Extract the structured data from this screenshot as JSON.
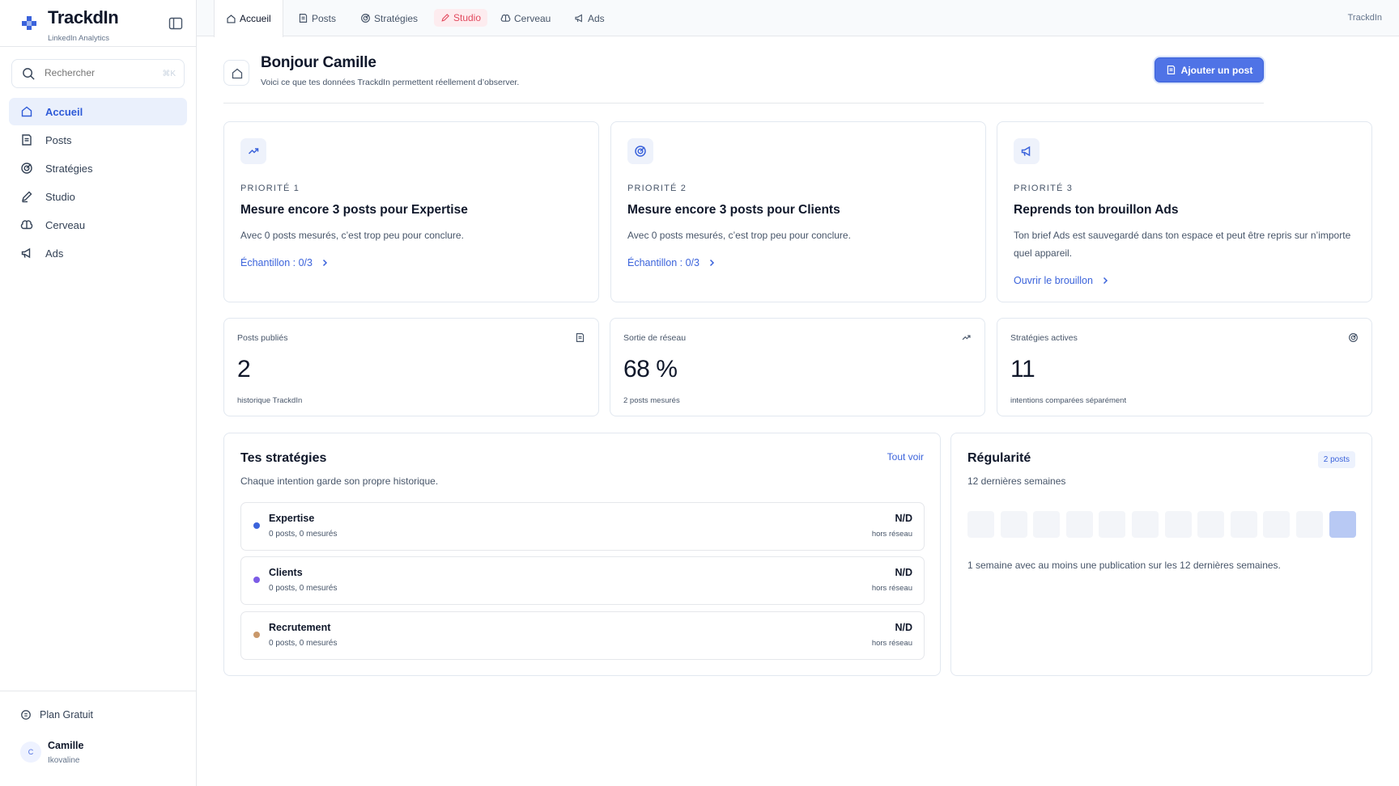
{
  "brand": {
    "name": "TrackdIn",
    "subtitle": "LinkedIn Analytics"
  },
  "search": {
    "placeholder": "Rechercher",
    "shortcut": "⌘K"
  },
  "sidebar": {
    "items": [
      {
        "label": "Accueil",
        "icon": "home-icon",
        "active": true
      },
      {
        "label": "Posts",
        "icon": "file-icon"
      },
      {
        "label": "Stratégies",
        "icon": "target-icon"
      },
      {
        "label": "Studio",
        "icon": "pen-icon"
      },
      {
        "label": "Cerveau",
        "icon": "brain-icon"
      },
      {
        "label": "Ads",
        "icon": "megaphone-icon"
      }
    ],
    "plan": "Plan Gratuit",
    "user": {
      "initial": "C",
      "name": "Camille",
      "org": "Ikovaline"
    }
  },
  "tabs": [
    {
      "label": "Accueil"
    },
    {
      "label": "Posts"
    },
    {
      "label": "Stratégies"
    },
    {
      "label": "Studio"
    },
    {
      "label": "Cerveau"
    },
    {
      "label": "Ads"
    }
  ],
  "tabbar_right": "TrackdIn",
  "header": {
    "title": "Bonjour Camille",
    "subtitle": "Voici ce que tes données TrackdIn permettent réellement d’observer.",
    "add_button": "Ajouter un post"
  },
  "priorities": [
    {
      "label": "PRIORITÉ 1",
      "title": "Mesure encore 3 posts pour Expertise",
      "desc": "Avec 0 posts mesurés, c’est trop peu pour conclure.",
      "link": "Échantillon : 0/3"
    },
    {
      "label": "PRIORITÉ 2",
      "title": "Mesure encore 3 posts pour Clients",
      "desc": "Avec 0 posts mesurés, c’est trop peu pour conclure.",
      "link": "Échantillon : 0/3"
    },
    {
      "label": "PRIORITÉ 3",
      "title": "Reprends ton brouillon Ads",
      "desc": "Ton brief Ads est sauvegardé dans ton espace et peut être repris sur n’importe quel appareil.",
      "link": "Ouvrir le brouillon"
    }
  ],
  "stats": [
    {
      "label": "Posts publiés",
      "value": "2",
      "note": "historique TrackdIn"
    },
    {
      "label": "Sortie de réseau",
      "value": "68 %",
      "note": "2 posts mesurés"
    },
    {
      "label": "Stratégies actives",
      "value": "11",
      "note": "intentions comparées séparément"
    }
  ],
  "strategies": {
    "title": "Tes stratégies",
    "subtitle": "Chaque intention garde son propre historique.",
    "see_all": "Tout voir",
    "rows": [
      {
        "name": "Expertise",
        "meta": "0 posts, 0 mesurés",
        "value": "N/D",
        "value_note": "hors réseau",
        "color": "#3b63db"
      },
      {
        "name": "Clients",
        "meta": "0 posts, 0 mesurés",
        "value": "N/D",
        "value_note": "hors réseau",
        "color": "#7c5ce6"
      },
      {
        "name": "Recrutement",
        "meta": "0 posts, 0 mesurés",
        "value": "N/D",
        "value_note": "hors réseau",
        "color": "#c9986b"
      }
    ]
  },
  "regularity": {
    "title": "Régularité",
    "subtitle": "12 dernières semaines",
    "badge": "2 posts",
    "weeks_active": [
      false,
      false,
      false,
      false,
      false,
      false,
      false,
      false,
      false,
      false,
      false,
      true
    ],
    "footer": "1 semaine avec au moins une publication sur les 12 dernières semaines."
  },
  "colors": {
    "accent": "#4f73e6",
    "link": "#3b63db",
    "studio": "#e2495e"
  }
}
